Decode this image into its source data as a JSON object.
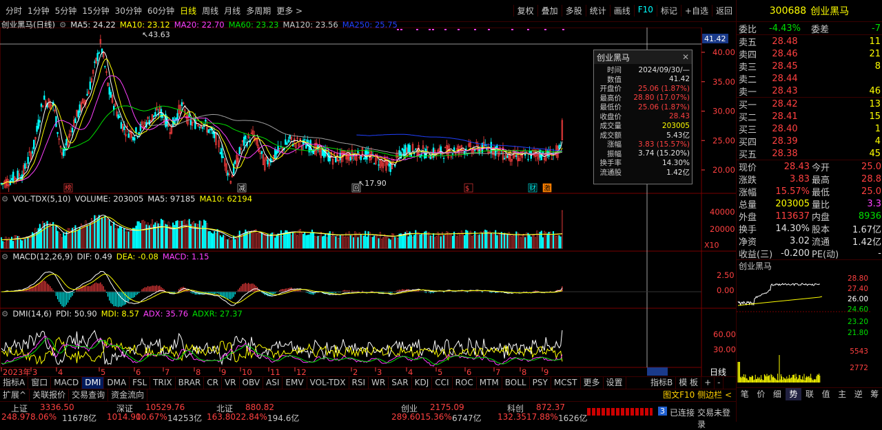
{
  "toolbar": {
    "periods": [
      "分时",
      "1分钟",
      "5分钟",
      "15分钟",
      "30分钟",
      "60分钟",
      "日线",
      "周线",
      "月线",
      "多周期",
      "更多 >"
    ],
    "active_period": "日线",
    "right": [
      "复权",
      "叠加",
      "多股",
      "统计",
      "画线",
      "F10",
      "标记",
      "+自选",
      "返回"
    ]
  },
  "main_legend": {
    "name": "创业黑马(日线)",
    "ma5": "MA5: 24.22",
    "ma10": "MA10: 23.12",
    "ma20": "MA20: 22.70",
    "ma60": "MA60: 23.23",
    "ma120": "MA120: 23.56",
    "ma250": "MA250: 25.75"
  },
  "price_axis": [
    "40.00",
    "35.00",
    "30.00",
    "25.00",
    "20.00"
  ],
  "current_price_tag": "41.42",
  "high_label": "43.63",
  "low_label": "17.90",
  "markers": [
    "榜",
    "减",
    "回",
    "$",
    "财",
    "激"
  ],
  "vol_legend": {
    "name": "VOL-TDX(5,10)",
    "volume": "VOLUME: 203005",
    "ma5": "MA5: 97185",
    "ma10": "MA10: 62194"
  },
  "vol_axis": [
    "40000",
    "20000"
  ],
  "vol_unit": "X10",
  "macd_legend": {
    "name": "MACD(12,26,9)",
    "dif": "DIF: 0.49",
    "dea": "DEA: -0.08",
    "macd": "MACD: 1.15"
  },
  "macd_axis": [
    "2.50",
    "0.00"
  ],
  "dmi_legend": {
    "name": "DMI(14,6)",
    "pdi": "PDI: 50.90",
    "mdi": "MDI: 8.57",
    "adx": "ADX: 35.76",
    "adxr": "ADXR: 27.37"
  },
  "dmi_axis": [
    "60.00",
    "30.00"
  ],
  "months": [
    "2023年",
    "3",
    "4",
    "5",
    "6",
    "7",
    "8",
    "9",
    "10",
    "11",
    "12",
    "2",
    "3",
    "4",
    "5",
    "6",
    "7",
    "8",
    "9"
  ],
  "period_tag": "日线",
  "popup": {
    "title": "创业黑马",
    "rows": [
      {
        "l": "时间",
        "v": "2024/09/30/—",
        "c": "white"
      },
      {
        "l": "数值",
        "v": "41.42",
        "c": "white"
      },
      {
        "l": "开盘价",
        "v": "25.06 (1.87%)",
        "c": "red"
      },
      {
        "l": "最高价",
        "v": "28.80 (17.07%)",
        "c": "red"
      },
      {
        "l": "最低价",
        "v": "25.06 (1.87%)",
        "c": "red"
      },
      {
        "l": "收盘价",
        "v": "28.43",
        "c": "red"
      },
      {
        "l": "成交量",
        "v": "203005",
        "c": "yellow"
      },
      {
        "l": "成交额",
        "v": "5.43亿",
        "c": "white"
      },
      {
        "l": "涨幅",
        "v": "3.83 (15.57%)",
        "c": "red"
      },
      {
        "l": "振幅",
        "v": "3.74 (15.20%)",
        "c": "white"
      },
      {
        "l": "换手率",
        "v": "14.30%",
        "c": "white"
      },
      {
        "l": "流通股",
        "v": "1.42亿",
        "c": "white"
      }
    ]
  },
  "indicator_tabs": [
    "指标A",
    "窗口",
    "MACD",
    "DMI",
    "DMA",
    "FSL",
    "TRIX",
    "BRAR",
    "CR",
    "VR",
    "OBV",
    "ASI",
    "EMV",
    "VOL-TDX",
    "RSI",
    "WR",
    "SAR",
    "KDJ",
    "CCI",
    "ROC",
    "MTM",
    "BOLL",
    "PSY",
    "MCST",
    "更多",
    "设置"
  ],
  "active_tab": "DMI",
  "right_tabs": [
    "指标B",
    "模 板",
    "+",
    "-"
  ],
  "ext_tabs": [
    "扩展^",
    "关联报价",
    "交易查询",
    "资金流向"
  ],
  "ext_right": "图文F10 侧边栏 <",
  "quote": {
    "code": "300688",
    "name": "创业黑马",
    "weibi": {
      "l": "委比",
      "v": "-4.43%",
      "l2": "委差",
      "v2": "-7"
    },
    "asks": [
      {
        "l": "卖五",
        "p": "28.48",
        "v": "11"
      },
      {
        "l": "卖四",
        "p": "28.46",
        "v": "21"
      },
      {
        "l": "卖三",
        "p": "28.45",
        "v": "8"
      },
      {
        "l": "卖二",
        "p": "28.44",
        "v": ""
      },
      {
        "l": "卖一",
        "p": "28.43",
        "v": "46"
      }
    ],
    "bids": [
      {
        "l": "买一",
        "p": "28.42",
        "v": "13"
      },
      {
        "l": "买二",
        "p": "28.41",
        "v": "15"
      },
      {
        "l": "买三",
        "p": "28.40",
        "v": "1"
      },
      {
        "l": "买四",
        "p": "28.39",
        "v": "4"
      },
      {
        "l": "买五",
        "p": "28.38",
        "v": "45"
      }
    ],
    "info": [
      [
        {
          "l": "现价",
          "v": "28.43",
          "c": "red"
        },
        {
          "l": "今开",
          "v": "25.0",
          "c": "red"
        }
      ],
      [
        {
          "l": "涨跌",
          "v": "3.83",
          "c": "red"
        },
        {
          "l": "最高",
          "v": "28.8",
          "c": "red"
        }
      ],
      [
        {
          "l": "涨幅",
          "v": "15.57%",
          "c": "red"
        },
        {
          "l": "最低",
          "v": "25.0",
          "c": "red"
        }
      ],
      [
        {
          "l": "总量",
          "v": "203005",
          "c": "yellow"
        },
        {
          "l": "量比",
          "v": "3.3",
          "c": "mag"
        }
      ],
      [
        {
          "l": "外盘",
          "v": "113637",
          "c": "red"
        },
        {
          "l": "内盘",
          "v": "8936",
          "c": "green"
        }
      ],
      [
        {
          "l": "换手",
          "v": "14.30%",
          "c": "white"
        },
        {
          "l": "股本",
          "v": "1.67亿",
          "c": "white"
        }
      ],
      [
        {
          "l": "净资",
          "v": "3.02",
          "c": "white"
        },
        {
          "l": "流通",
          "v": "1.42亿",
          "c": "white"
        }
      ],
      [
        {
          "l": "收益(三)",
          "v": "-0.200",
          "c": "white"
        },
        {
          "l": "PE(动)",
          "v": "-",
          "c": "white"
        }
      ]
    ],
    "mini_title": "创业黑马",
    "mini_axis": [
      "28.80",
      "27.40",
      "26.00",
      "24.60",
      "23.20",
      "21.80",
      "5543",
      "2772"
    ],
    "bottom_tabs": [
      "笔",
      "价",
      "细",
      "势",
      "联",
      "值",
      "主",
      "逆",
      "筹"
    ],
    "active_bottom": "势"
  },
  "status": {
    "items": [
      {
        "name": "上证",
        "v": "3336.50",
        "d": "248.97",
        "p": "8.06%",
        "a": "11678亿"
      },
      {
        "name": "深证",
        "v": "10529.76",
        "d": "1014.90",
        "p": "10.67%",
        "a": "14253亿"
      },
      {
        "name": "北证",
        "v": "880.82",
        "d": "163.80",
        "p": "22.84%",
        "a": "194.6亿"
      },
      {
        "name": "创业",
        "v": "2175.09",
        "d": "289.60",
        "p": "15.36%",
        "a": "6747亿"
      },
      {
        "name": "科创",
        "v": "872.37",
        "d": "132.35",
        "p": "17.88%",
        "a": "1626亿"
      }
    ],
    "conn_badge": "3",
    "connected": "已连接",
    "trade": "交易未登录"
  },
  "colors": {
    "up": "#ff4040",
    "down": "#00ffff",
    "ma5": "#ffffff",
    "ma10": "#ffff00",
    "ma20": "#ff40ff",
    "ma60": "#00e000",
    "ma120": "#a0a0a0",
    "ma250": "#2040ff"
  }
}
